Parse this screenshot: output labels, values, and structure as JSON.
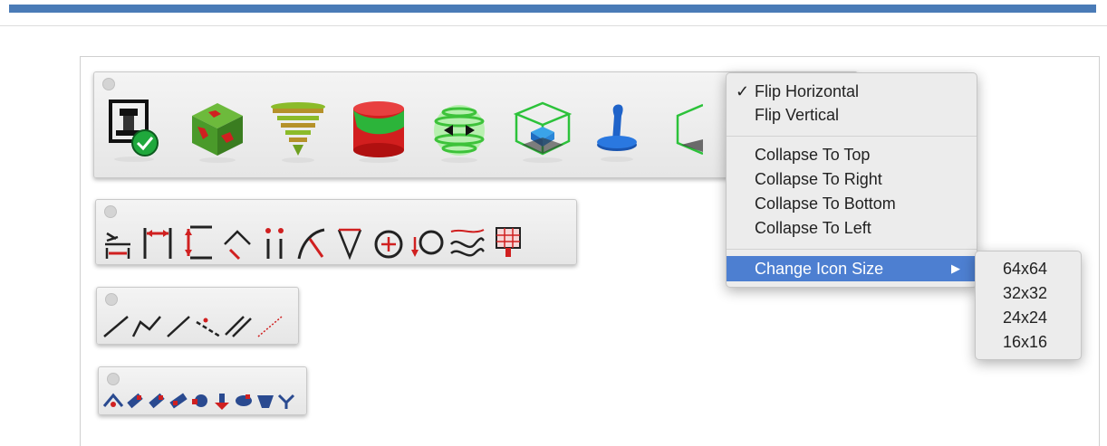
{
  "toolbars": [
    {
      "name": "main-toolbar",
      "icons": [
        "printer-check-icon",
        "textured-cube-icon",
        "cone-layers-icon",
        "cylinder-icon",
        "sphere-arrows-icon",
        "wireframe-cube-icon",
        "blue-post-icon",
        "cube-partial-icon"
      ]
    },
    {
      "name": "dimension-toolbar",
      "icons": [
        "base-dimension-icon",
        "horizontal-dimension-icon",
        "vertical-dimension-icon",
        "angle-dimension-icon",
        "point-dimension-icon",
        "arc-dimension-icon",
        "triangle-dimension-icon",
        "circle-dimension-icon",
        "radius-dimension-icon",
        "wave-dimension-icon",
        "grid-dimension-icon"
      ]
    },
    {
      "name": "line-toolbar",
      "icons": [
        "line-icon",
        "polyline-icon",
        "slash-line-icon",
        "dashed-line-icon",
        "double-line-icon",
        "dotted-line-icon"
      ]
    },
    {
      "name": "small-tool-toolbar",
      "icons": [
        "tool-1-icon",
        "tool-2-icon",
        "tool-3-icon",
        "tool-4-icon",
        "tool-5-icon",
        "tool-6-icon",
        "tool-7-icon",
        "tool-8-icon",
        "tool-9-icon"
      ]
    }
  ],
  "context_menu": {
    "check_mark": "✓",
    "flip_horizontal": "Flip Horizontal",
    "flip_vertical": "Flip Vertical",
    "collapse_top": "Collapse To Top",
    "collapse_right": "Collapse To Right",
    "collapse_bottom": "Collapse To Bottom",
    "collapse_left": "Collapse To Left",
    "change_icon_size": "Change Icon Size",
    "submenu_arrow": "▶",
    "highlight_color": "#4d7fd1"
  },
  "icon_size_submenu": {
    "options": [
      "64x64",
      "32x32",
      "24x24",
      "16x16"
    ]
  },
  "colors": {
    "accent_bar": "#4a7bb7"
  }
}
